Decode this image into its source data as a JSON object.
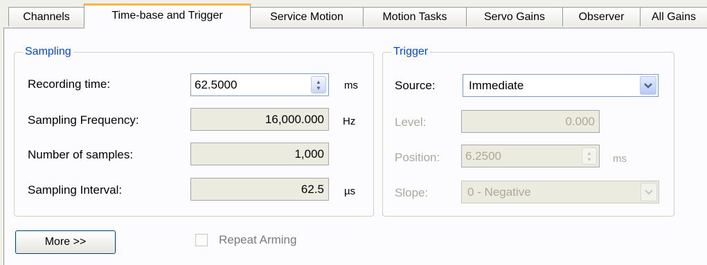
{
  "tabs": [
    {
      "label": "Channels"
    },
    {
      "label": "Time-base and Trigger"
    },
    {
      "label": "Service Motion"
    },
    {
      "label": "Motion Tasks"
    },
    {
      "label": "Servo Gains"
    },
    {
      "label": "Observer"
    },
    {
      "label": "All Gains"
    }
  ],
  "active_tab": "Time-base and Trigger",
  "sampling": {
    "legend": "Sampling",
    "recording_time": {
      "label": "Recording time:",
      "value": "62.5000",
      "unit": "ms"
    },
    "sampling_frequency": {
      "label": "Sampling Frequency:",
      "value": "16,000.000",
      "unit": "Hz"
    },
    "number_of_samples": {
      "label": "Number of samples:",
      "value": "1,000"
    },
    "sampling_interval": {
      "label": "Sampling Interval:",
      "value": "62.5",
      "unit": "µs"
    }
  },
  "trigger": {
    "legend": "Trigger",
    "source": {
      "label": "Source:",
      "value": "Immediate"
    },
    "level": {
      "label": "Level:",
      "value": "0.000"
    },
    "position": {
      "label": "Position:",
      "value": "6.2500",
      "unit": "ms"
    },
    "slope": {
      "label": "Slope:",
      "value": "0 - Negative"
    }
  },
  "more_button": {
    "label": "More >>"
  },
  "repeat_arming": {
    "label": "Repeat Arming",
    "checked": false
  },
  "colors": {
    "accent_tab": "#f7b64a",
    "legend_text": "#0046d5",
    "disabled_text": "#aca899"
  }
}
